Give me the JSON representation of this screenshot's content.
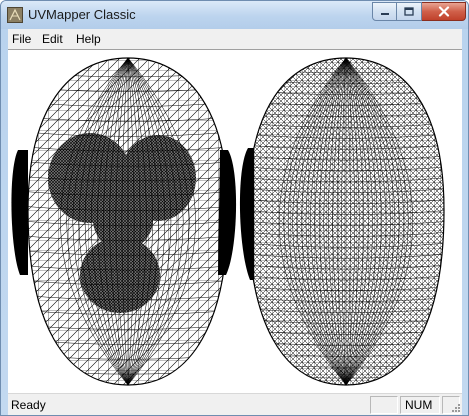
{
  "window": {
    "title": "UVMapper Classic",
    "app_icon": "uvmapper-icon",
    "controls": {
      "minimize_icon": "minimize-icon",
      "maximize_icon": "maximize-icon",
      "close_icon": "close-icon"
    }
  },
  "menu": {
    "items": [
      {
        "label": "File"
      },
      {
        "label": "Edit"
      },
      {
        "label": "Help"
      }
    ]
  },
  "canvas": {
    "content": "uv-map-wireframe",
    "wire_color": "#000000",
    "background_color": "#ffffff"
  },
  "status": {
    "text": "Ready",
    "num_indicator": "NUM"
  },
  "colors": {
    "title_bar": "#bcd4ee",
    "close_button": "#c0412b",
    "menu_background": "#f0f0f0"
  }
}
